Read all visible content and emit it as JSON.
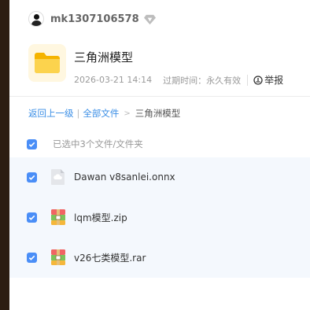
{
  "user": {
    "name": "mk1307106578",
    "badge_icon": "vip-diamond-icon",
    "avatar_icon": "avatar-icon"
  },
  "folder": {
    "icon": "folder-icon",
    "accent_color": "#f8c531",
    "title": "三角洲模型",
    "date": "2026-03-21 14:14",
    "expiry_label": "过期时间：永久有效",
    "report_label": "举报"
  },
  "breadcrumb": {
    "back": "返回上一级",
    "all_files": "全部文件",
    "separator": "|",
    "arrow": ">",
    "current": "三角洲模型"
  },
  "selection": {
    "checked": true,
    "label": "已选中3个文件/文件夹"
  },
  "files": [
    {
      "name": "Dawan v8sanlei.onnx",
      "icon": "generic-file-icon",
      "checked": true
    },
    {
      "name": "lqm模型.zip",
      "icon": "archive-file-icon",
      "checked": true
    },
    {
      "name": "v26七类模型.rar",
      "icon": "archive-file-icon",
      "checked": true
    }
  ],
  "colors": {
    "link": "#3a8ee6",
    "checkbox": "#4a8ef7",
    "list_background": "#f4f8fd",
    "sidebar": "#2c1d12"
  }
}
